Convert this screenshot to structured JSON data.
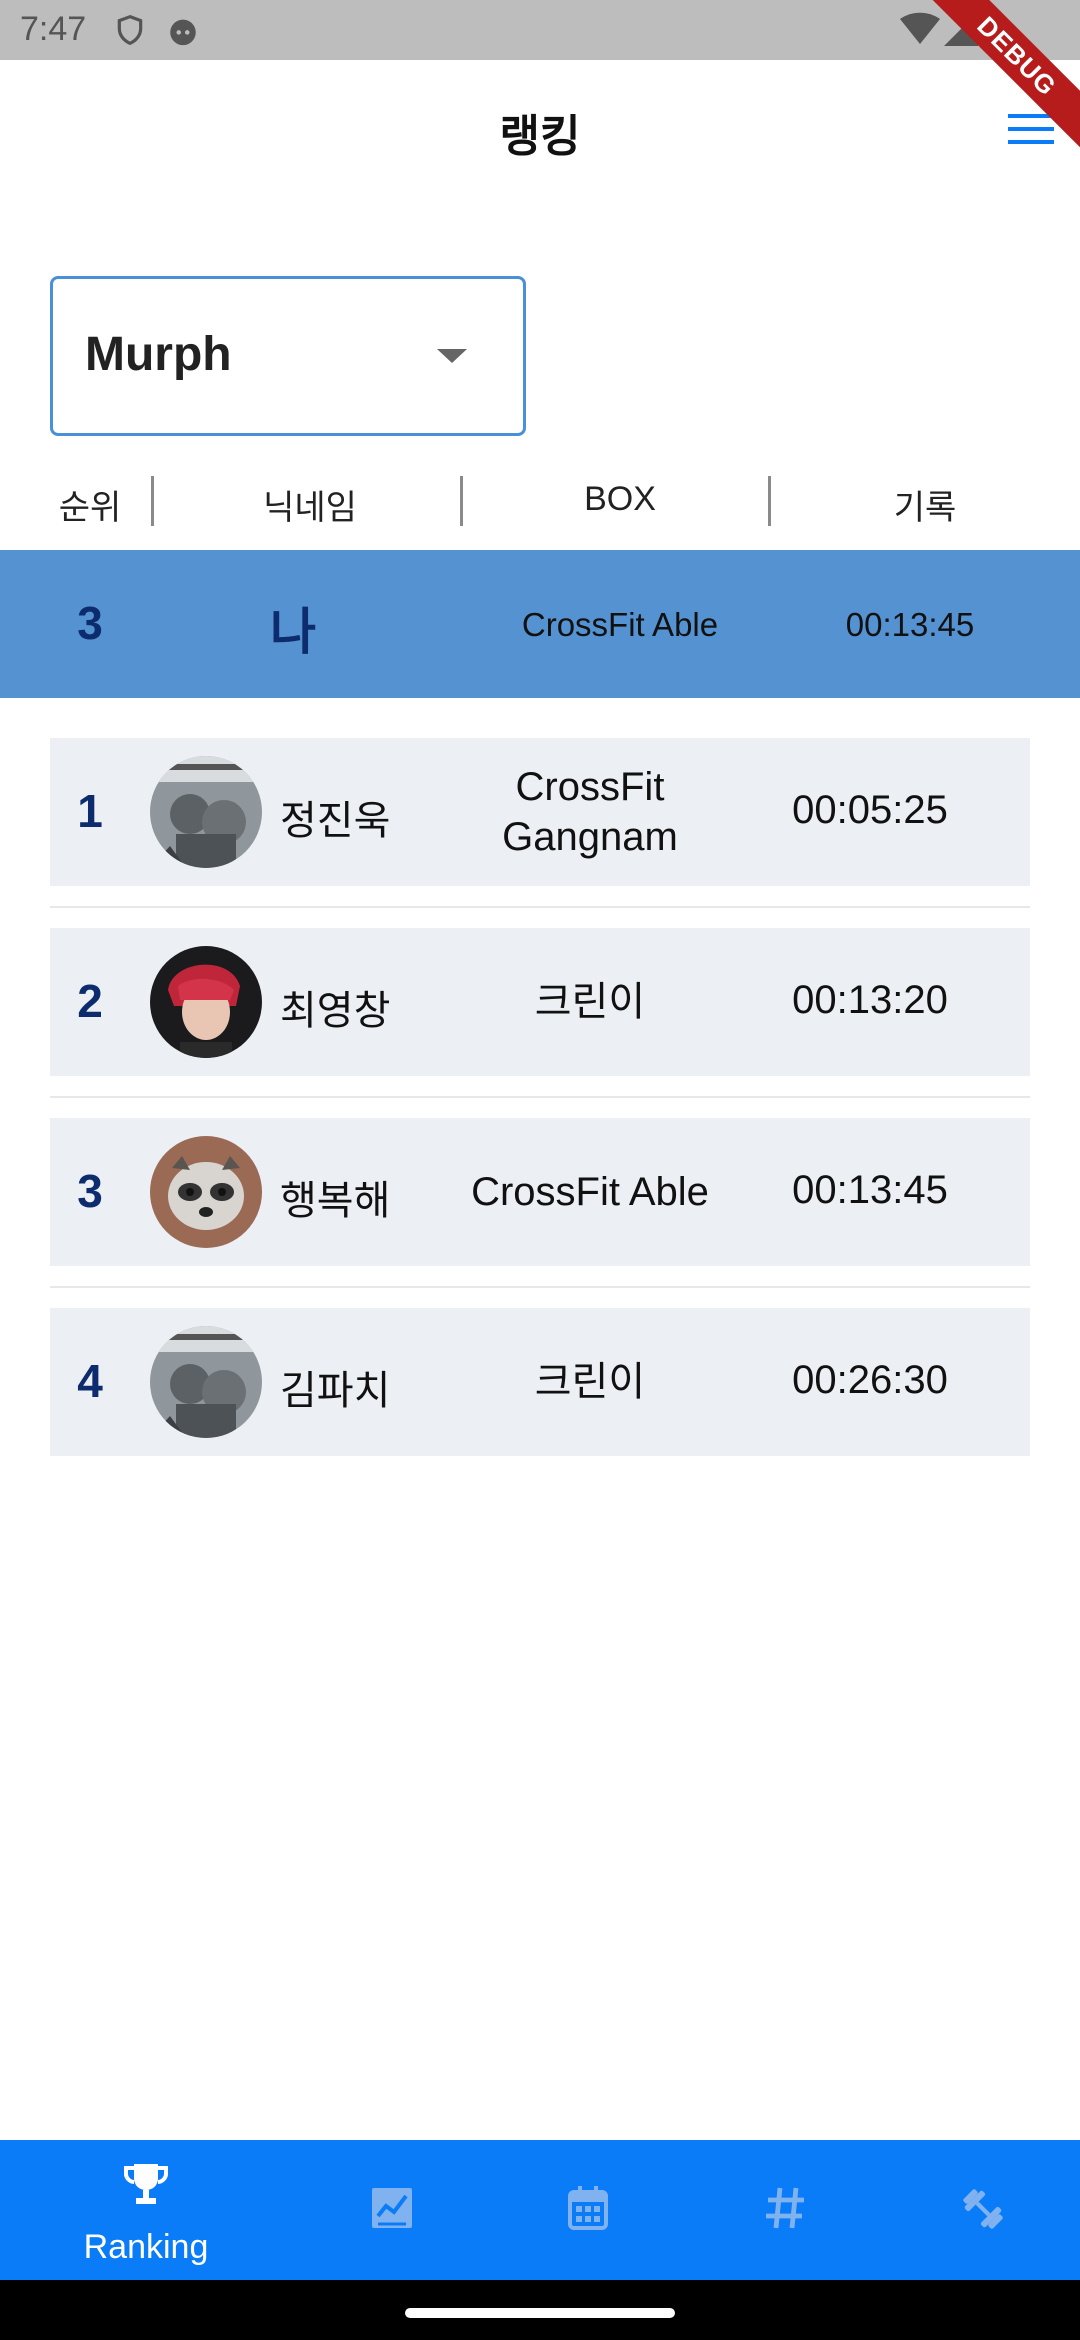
{
  "status": {
    "time": "7:47",
    "debug_label": "DEBUG"
  },
  "header": {
    "title": "랭킹"
  },
  "dropdown": {
    "selected": "Murph"
  },
  "table_header": {
    "rank": "순위",
    "nickname": "닉네임",
    "box": "BOX",
    "record": "기록"
  },
  "my_row": {
    "rank": "3",
    "name": "나",
    "box": "CrossFit Able",
    "record": "00:13:45"
  },
  "rankings": [
    {
      "rank": "1",
      "name": "정진욱",
      "box_line1": "CrossFit",
      "box_line2": "Gangnam",
      "record": "00:05:25",
      "avatar": "muscle-drawing"
    },
    {
      "rank": "2",
      "name": "최영창",
      "box_line1": "크린이",
      "box_line2": "",
      "record": "00:13:20",
      "avatar": "red-hair-person"
    },
    {
      "rank": "3",
      "name": "행복해",
      "box_line1": "CrossFit Able",
      "box_line2": "",
      "record": "00:13:45",
      "avatar": "raccoon"
    },
    {
      "rank": "4",
      "name": "김파치",
      "box_line1": "크린이",
      "box_line2": "",
      "record": "00:26:30",
      "avatar": "muscle-drawing"
    }
  ],
  "bottom_nav": {
    "items": [
      {
        "label": "Ranking",
        "icon": "trophy-icon",
        "active": true
      },
      {
        "label": "",
        "icon": "chart-icon"
      },
      {
        "label": "",
        "icon": "calendar-icon"
      },
      {
        "label": "",
        "icon": "hashtag-icon"
      },
      {
        "label": "",
        "icon": "dumbbell-icon"
      }
    ]
  },
  "colors": {
    "accent": "#0a7cf7",
    "my_row_bg": "#5592d1",
    "rank_text": "#0d2c6e",
    "row_bg": "#eceff3",
    "inactive_icon": "#7fb2ef"
  }
}
